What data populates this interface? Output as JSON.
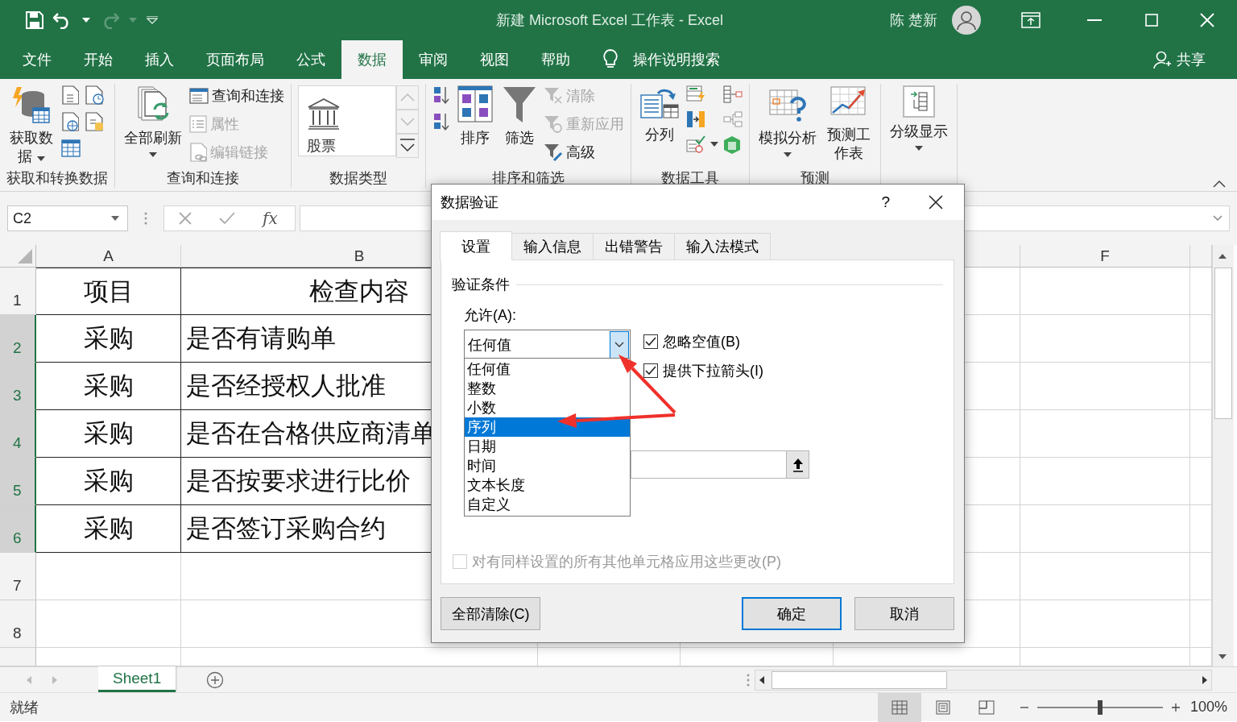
{
  "title_bar": {
    "title": "新建 Microsoft Excel 工作表 - Excel",
    "user": "陈 楚新"
  },
  "menu_tabs": [
    {
      "label": "文件",
      "selected": false
    },
    {
      "label": "开始",
      "selected": false
    },
    {
      "label": "插入",
      "selected": false
    },
    {
      "label": "页面布局",
      "selected": false
    },
    {
      "label": "公式",
      "selected": false
    },
    {
      "label": "数据",
      "selected": true
    },
    {
      "label": "审阅",
      "selected": false
    },
    {
      "label": "视图",
      "selected": false
    },
    {
      "label": "帮助",
      "selected": false
    }
  ],
  "tell_me": "操作说明搜索",
  "share": "共享",
  "ribbon_groups": [
    {
      "label": "获取和转换数据",
      "items": [
        {
          "kind": "large",
          "label": "获取数据",
          "dropdown": true
        },
        {
          "kind": "icon"
        },
        {
          "kind": "icon"
        },
        {
          "kind": "icon"
        },
        {
          "kind": "icon"
        },
        {
          "kind": "icon"
        }
      ]
    },
    {
      "label": "查询和连接",
      "items": [
        {
          "kind": "large",
          "label": "全部刷新",
          "dropdown": true
        },
        {
          "kind": "small",
          "label": "查询和连接",
          "disabled": false
        },
        {
          "kind": "small",
          "label": "属性",
          "disabled": true
        },
        {
          "kind": "small",
          "label": "编辑链接",
          "disabled": true
        }
      ]
    },
    {
      "label": "数据类型",
      "items": [
        {
          "kind": "gallery",
          "label": "股票"
        }
      ]
    },
    {
      "label": "排序和筛选",
      "items": [
        {
          "kind": "icon"
        },
        {
          "kind": "icon"
        },
        {
          "kind": "large",
          "label": "排序",
          "dropdown": false
        },
        {
          "kind": "large",
          "label": "筛选",
          "dropdown": false
        },
        {
          "kind": "small",
          "label": "清除",
          "disabled": true
        },
        {
          "kind": "small",
          "label": "重新应用",
          "disabled": true
        },
        {
          "kind": "small",
          "label": "高级",
          "disabled": false
        }
      ]
    },
    {
      "label": "数据工具",
      "items": [
        {
          "kind": "large",
          "label": "分列",
          "dropdown": false
        },
        {
          "kind": "icon"
        },
        {
          "kind": "icon"
        },
        {
          "kind": "icon"
        },
        {
          "kind": "icon"
        },
        {
          "kind": "icon"
        },
        {
          "kind": "icon"
        }
      ]
    },
    {
      "label": "预测",
      "items": [
        {
          "kind": "large",
          "label": "模拟分析",
          "dropdown": true
        },
        {
          "kind": "large",
          "label": "预测工作表",
          "dropdown": false
        }
      ]
    },
    {
      "items": [
        {
          "kind": "large",
          "label": "分级显示",
          "dropdown": true
        }
      ]
    }
  ],
  "formula_bar": {
    "name_box": "C2",
    "function_label": "fx"
  },
  "sheet": {
    "columns": [
      {
        "label": "A"
      },
      {
        "label": "B"
      },
      {
        "label": "F"
      }
    ],
    "rows": [
      {
        "number": "1",
        "selected": false,
        "kind": "header",
        "cells": [
          "项目",
          "检查内容"
        ]
      },
      {
        "number": "2",
        "selected": true,
        "kind": "item",
        "cells": [
          "采购",
          "是否有请购单"
        ]
      },
      {
        "number": "3",
        "selected": true,
        "kind": "item",
        "cells": [
          "采购",
          "是否经授权人批准"
        ]
      },
      {
        "number": "4",
        "selected": true,
        "kind": "item",
        "cells": [
          "采购",
          "是否在合格供应商清单"
        ]
      },
      {
        "number": "5",
        "selected": true,
        "kind": "item",
        "cells": [
          "采购",
          "是否按要求进行比价"
        ]
      },
      {
        "number": "6",
        "selected": true,
        "kind": "item",
        "cells": [
          "采购",
          "是否签订采购合约"
        ]
      },
      {
        "number": "7",
        "selected": false,
        "kind": "empty"
      },
      {
        "number": "8",
        "selected": false,
        "kind": "empty"
      }
    ]
  },
  "sheet_tabs": [
    {
      "label": "Sheet1",
      "selected": true
    }
  ],
  "status_bar": {
    "status": "就绪",
    "view_buttons": [
      {
        "selected": true
      },
      {
        "selected": false
      },
      {
        "selected": false
      }
    ],
    "zoom": {
      "level": 0.5,
      "reading": "100%"
    }
  },
  "dialog": {
    "title": "数据验证",
    "help": "?",
    "tabs": [
      {
        "label": "设置",
        "selected": true
      },
      {
        "label": "输入信息",
        "selected": false
      },
      {
        "label": "出错警告",
        "selected": false
      },
      {
        "label": "输入法模式",
        "selected": false
      }
    ],
    "section": "验证条件",
    "allow_label": "允许(A):",
    "allow_value": "任何值",
    "allow_options": [
      {
        "label": "任何值",
        "selected": false
      },
      {
        "label": "整数",
        "selected": false
      },
      {
        "label": "小数",
        "selected": false
      },
      {
        "label": "序列",
        "selected": true
      },
      {
        "label": "日期",
        "selected": false
      },
      {
        "label": "时间",
        "selected": false
      },
      {
        "label": "文本长度",
        "selected": false
      },
      {
        "label": "自定义",
        "selected": false
      }
    ],
    "checkboxes": [
      {
        "label": "忽略空值(B)",
        "checked": true
      },
      {
        "label": "提供下拉箭头(I)",
        "checked": true
      }
    ],
    "apply_all": {
      "label": "对有同样设置的所有其他单元格应用这些更改(P)",
      "checked": false,
      "disabled": true
    },
    "buttons": [
      {
        "label": "全部清除(C)",
        "kind": "normal"
      },
      {
        "label": "确定",
        "kind": "default"
      },
      {
        "label": "取消",
        "kind": "normal"
      }
    ]
  }
}
